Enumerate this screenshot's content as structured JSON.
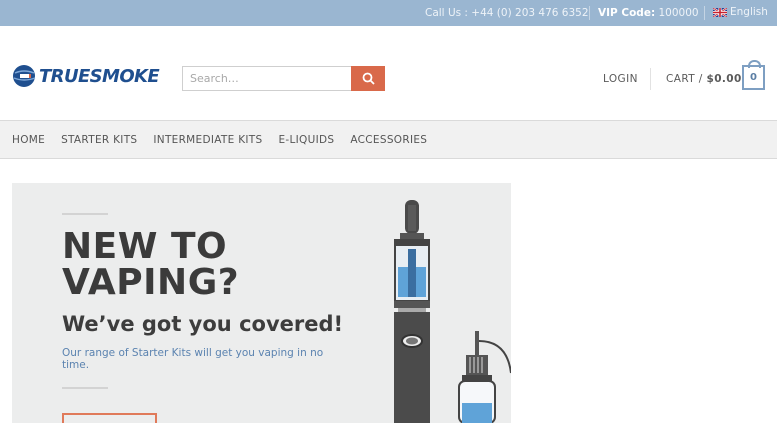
{
  "topbar": {
    "call": "Call Us : +44 (0) 203 476 6352",
    "vip_label": "VIP Code:",
    "vip_value": "100000",
    "language": "English"
  },
  "header": {
    "logo_text": "TRUESMOKE",
    "search_placeholder": "Search…",
    "login": "LOGIN",
    "cart_label": "CART /",
    "cart_total": "$0.00",
    "cart_count": "0"
  },
  "nav": {
    "items": [
      "HOME",
      "STARTER KITS",
      "INTERMEDIATE KITS",
      "E-LIQUIDS",
      "ACCESSORIES"
    ]
  },
  "hero": {
    "title_line1": "NEW TO",
    "title_line2": "VAPING?",
    "subtitle": "We’ve got you covered!",
    "body": "Our range of Starter Kits will get you vaping in no time."
  },
  "colors": {
    "topbar": "#9ab6d1",
    "accent": "#d9694a",
    "brand_blue": "#1f4f8f",
    "hero_bg": "#eceded"
  }
}
